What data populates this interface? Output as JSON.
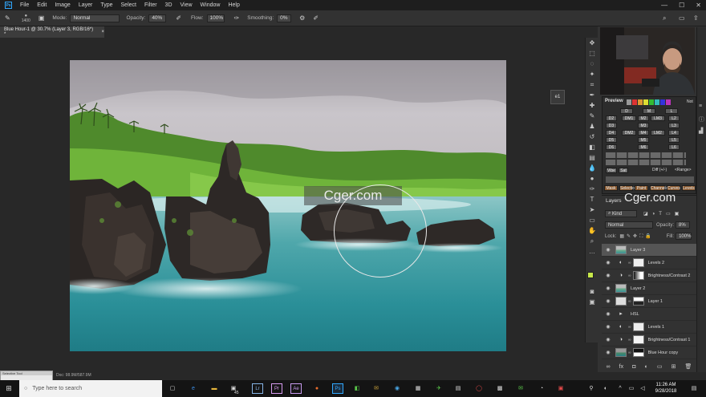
{
  "menu": {
    "items": [
      "File",
      "Edit",
      "Image",
      "Layer",
      "Type",
      "Select",
      "Filter",
      "3D",
      "View",
      "Window",
      "Help"
    ]
  },
  "options_bar": {
    "brush_size": "1400",
    "mode_label": "Mode:",
    "mode_value": "Normal",
    "opacity_label": "Opacity:",
    "opacity_value": "40%",
    "flow_label": "Flow:",
    "flow_value": "100%",
    "smoothing_label": "Smoothing:",
    "smoothing_value": "0%"
  },
  "document": {
    "tab_title": "Blue Hour-1 @ 30.7% (Layer 3, RGB/16*) *",
    "close": "×",
    "status_text": "Doc: 98.9M/587.9M"
  },
  "watermark": "Cger.com",
  "nav_button": "e1",
  "plugin": {
    "preview_label": "Preview",
    "row1": [
      "D",
      "M",
      "L"
    ],
    "row2": [
      "D2",
      "DM1",
      "M2",
      "LM3",
      "L2"
    ],
    "row3": [
      "D3",
      "M3",
      "L3"
    ],
    "row4": [
      "D4",
      "DM2",
      "M4",
      "LM2",
      "L4"
    ],
    "row5": [
      "D5",
      "M5",
      "L5"
    ],
    "row6": [
      "D6",
      "M6",
      "L6"
    ],
    "vibe": "Vibe",
    "sat": "Sat",
    "diff": "Diff (+/-)",
    "range": "<Range>",
    "not": "Not",
    "bottom_buttons": [
      "Mask",
      "Selection",
      "Paint",
      "Channels",
      "Curves",
      "Levels"
    ]
  },
  "layers": {
    "title": "Layers",
    "kind": "Kind",
    "blend": "Normal",
    "opacity_label": "Opacity:",
    "opacity_value": "8%",
    "lock_label": "Lock:",
    "fill_label": "Fill:",
    "fill_value": "100%",
    "list": [
      {
        "name": "Layer 3",
        "type": "pixel",
        "selected": true
      },
      {
        "name": "Levels 2",
        "type": "adjust-mask",
        "selected": false
      },
      {
        "name": "Brightness/Contrast 2",
        "type": "adjust-mask",
        "selected": false
      },
      {
        "name": "Layer 2",
        "type": "pixel",
        "selected": false
      },
      {
        "name": "Layer 1",
        "type": "pixel-mask",
        "selected": false
      },
      {
        "name": "HSL",
        "type": "group",
        "selected": false
      },
      {
        "name": "Levels 1",
        "type": "adjust-mask",
        "selected": false
      },
      {
        "name": "Brightness/Contrast 1",
        "type": "adjust-mask",
        "selected": false
      },
      {
        "name": "Blue Hour copy",
        "type": "pixel-mask",
        "selected": false
      }
    ],
    "footer_icons": [
      "link-icon",
      "fx-icon",
      "mask-icon",
      "adjustment-icon",
      "folder-icon",
      "new-layer-icon",
      "trash-icon"
    ]
  },
  "taskbar": {
    "search_placeholder": "Type here to search",
    "badge": "45",
    "apps": [
      "Lr",
      "Pr",
      "Ae",
      "Ps"
    ],
    "time": "11:26 AM",
    "date": "9/28/2018"
  },
  "popup_text": "Selective Tool",
  "colors": {
    "ps_blue": "#31a8ff",
    "foreground_swatch": "#c7e84a",
    "background_swatch": "#d8e95d"
  }
}
